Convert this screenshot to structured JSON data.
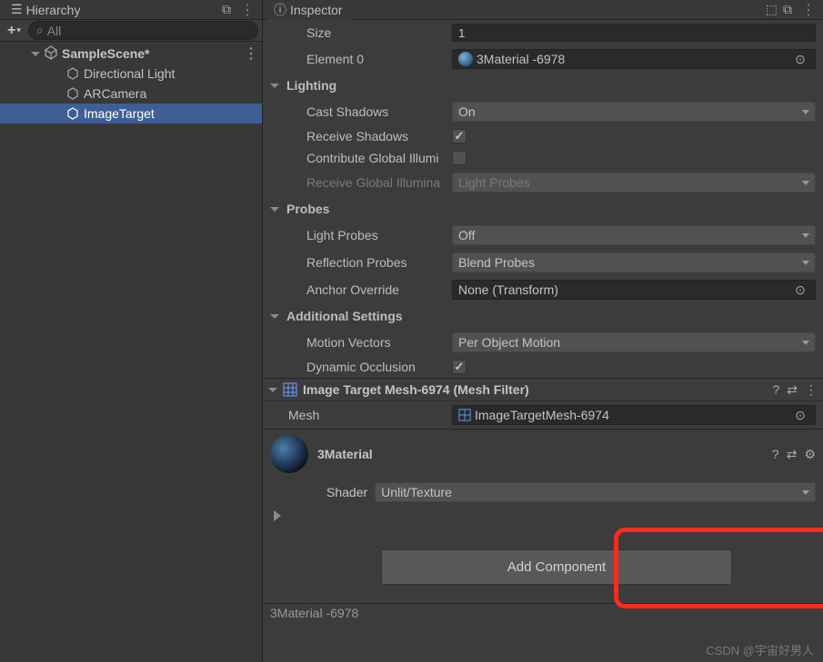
{
  "hierarchy": {
    "tab_label": "Hierarchy",
    "search_placeholder": "All",
    "scene": "SampleScene*",
    "items": [
      {
        "label": "Directional Light"
      },
      {
        "label": "ARCamera"
      },
      {
        "label": "ImageTarget"
      }
    ]
  },
  "inspector": {
    "tab_label": "Inspector",
    "size_label": "Size",
    "size_value": "1",
    "element0_label": "Element 0",
    "element0_value": "3Material -6978",
    "lighting": {
      "title": "Lighting",
      "cast_shadows_label": "Cast Shadows",
      "cast_shadows_value": "On",
      "receive_shadows_label": "Receive Shadows",
      "contribute_gi_label": "Contribute Global Illumi",
      "receive_gi_label": "Receive Global Illumina",
      "receive_gi_value": "Light Probes"
    },
    "probes": {
      "title": "Probes",
      "light_probes_label": "Light Probes",
      "light_probes_value": "Off",
      "reflection_probes_label": "Reflection Probes",
      "reflection_probes_value": "Blend Probes",
      "anchor_override_label": "Anchor Override",
      "anchor_override_value": "None (Transform)"
    },
    "additional": {
      "title": "Additional Settings",
      "motion_vectors_label": "Motion Vectors",
      "motion_vectors_value": "Per Object Motion",
      "dynamic_occlusion_label": "Dynamic Occlusion"
    },
    "mesh_filter": {
      "title": "Image Target Mesh-6974 (Mesh Filter)",
      "mesh_label": "Mesh",
      "mesh_value": "ImageTargetMesh-6974"
    },
    "material": {
      "name": "3Material",
      "shader_label": "Shader",
      "shader_value": "Unlit/Texture"
    },
    "add_component_label": "Add Component",
    "footer_material": "3Material -6978"
  },
  "watermark": "CSDN @宇宙好男人"
}
